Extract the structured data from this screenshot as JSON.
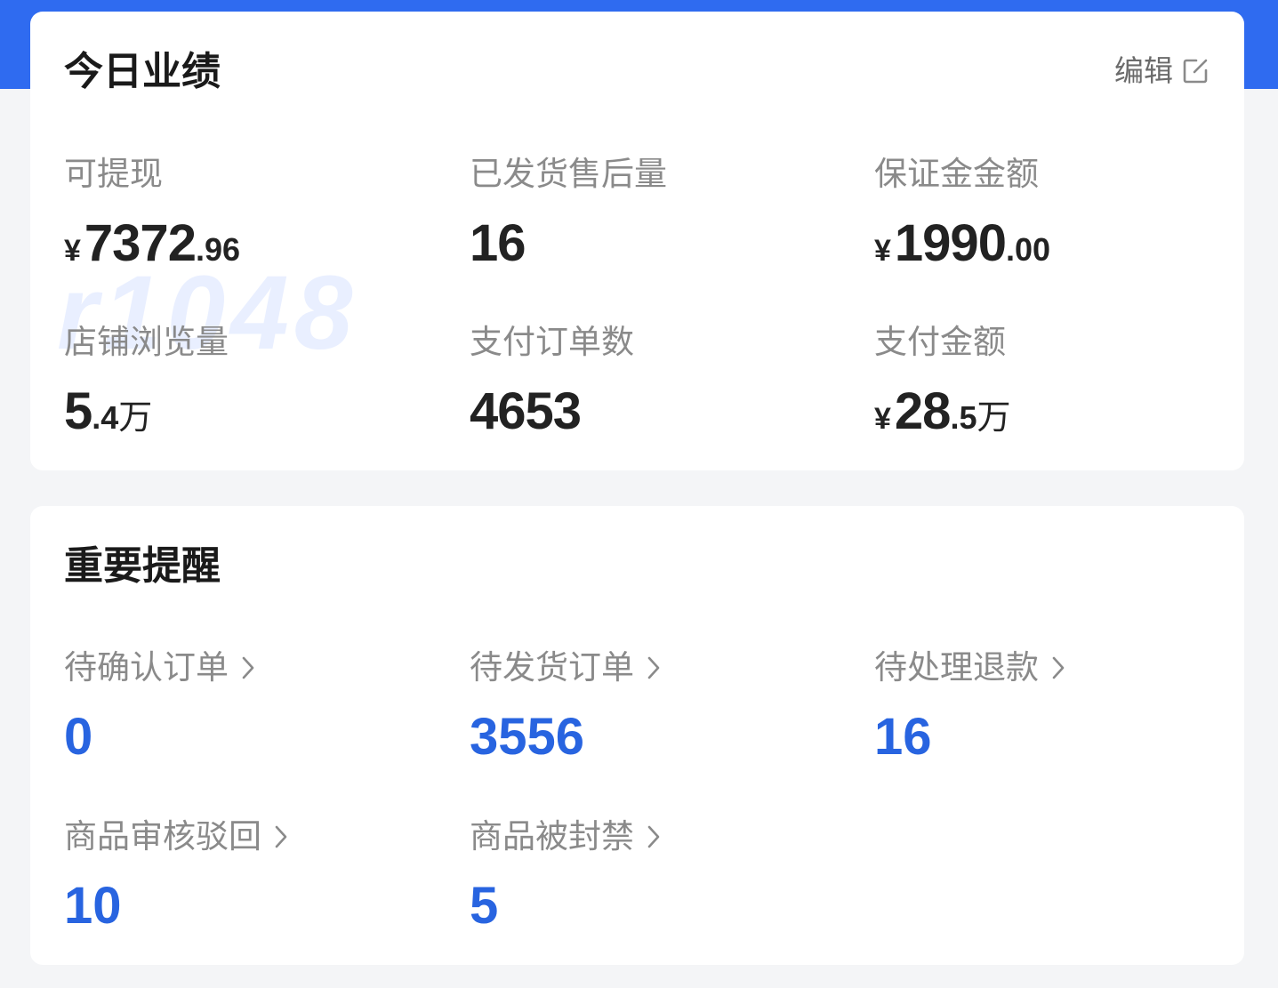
{
  "performance": {
    "title": "今日业绩",
    "edit_label": "编辑",
    "metrics": [
      {
        "label": "可提现",
        "currency": "¥",
        "integer": "7372",
        "decimal": ".96",
        "unit": ""
      },
      {
        "label": "已发货售后量",
        "currency": "",
        "integer": "16",
        "decimal": "",
        "unit": ""
      },
      {
        "label": "保证金金额",
        "currency": "¥",
        "integer": "1990",
        "decimal": ".00",
        "unit": ""
      },
      {
        "label": "店铺浏览量",
        "currency": "",
        "integer": "5",
        "decimal": ".4",
        "unit": "万"
      },
      {
        "label": "支付订单数",
        "currency": "",
        "integer": "4653",
        "decimal": "",
        "unit": ""
      },
      {
        "label": "支付金额",
        "currency": "¥",
        "integer": "28",
        "decimal": ".5",
        "unit": "万"
      }
    ]
  },
  "reminders": {
    "title": "重要提醒",
    "items": [
      {
        "label": "待确认订单",
        "value": "0"
      },
      {
        "label": "待发货订单",
        "value": "3556"
      },
      {
        "label": "待处理退款",
        "value": "16"
      },
      {
        "label": "商品审核驳回",
        "value": "10"
      },
      {
        "label": "商品被封禁",
        "value": "5"
      }
    ]
  },
  "watermark": "r1048",
  "colors": {
    "accent": "#2f6bf0",
    "value_blue": "#2864e0",
    "label_gray": "#8a8a8a"
  },
  "icons": {
    "edit": "edit-square-icon",
    "chevron": "chevron-right-icon"
  }
}
